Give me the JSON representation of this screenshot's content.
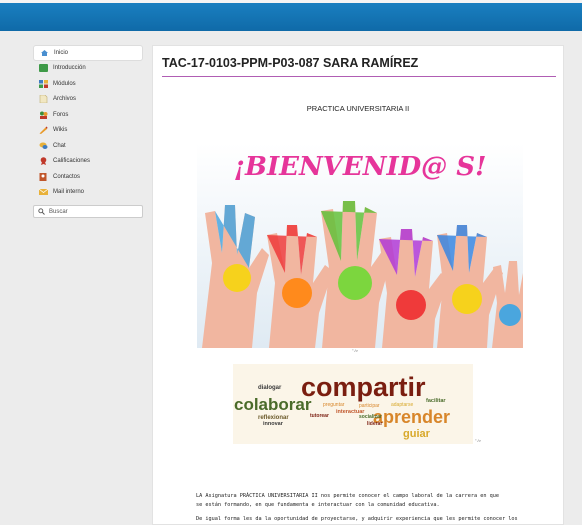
{
  "nav": {
    "items": [
      {
        "label": "Inicio",
        "icon": "home-icon",
        "color": "#4a8fd0",
        "active": true
      },
      {
        "label": "Introducción",
        "icon": "intro-icon",
        "color": "#3e9a48",
        "active": false
      },
      {
        "label": "Módulos",
        "icon": "modules-icon",
        "color": "#3e7bc0",
        "active": false
      },
      {
        "label": "Archivos",
        "icon": "files-icon",
        "color": "#e8d8a0",
        "active": false
      },
      {
        "label": "Foros",
        "icon": "forum-icon",
        "color": "#3c8d3c",
        "active": false
      },
      {
        "label": "Wikis",
        "icon": "wiki-icon",
        "color": "#e89a2a",
        "active": false
      },
      {
        "label": "Chat",
        "icon": "chat-icon",
        "color": "#e8b13a",
        "active": false
      },
      {
        "label": "Calificaciones",
        "icon": "grades-icon",
        "color": "#c0392b",
        "active": false
      },
      {
        "label": "Contactos",
        "icon": "contacts-icon",
        "color": "#c0562b",
        "active": false
      },
      {
        "label": "Mail interno",
        "icon": "mail-icon",
        "color": "#e8b13a",
        "active": false
      }
    ],
    "search_label": "Buscar"
  },
  "main": {
    "title": "TAC-17-0103-PPM-P03-087 SARA RAMÍREZ",
    "subtitle": "PRACTICA UNIVERSITARIA II",
    "banner_text": "¡BIENVENID@ S!",
    "caption1": "\" />",
    "caption2": "\" />",
    "cloud_words": {
      "w1": "compartir",
      "w2": "colaborar",
      "w3": "aprender",
      "w4": "guiar",
      "w5": "dialogar",
      "w6": "reflexionar",
      "w7": "innovar",
      "w8": "tutorear",
      "w9": "interactuar",
      "w10": "socializar",
      "w11": "liderar",
      "w12": "participar",
      "w13": "adaptarse",
      "w14": "facilitar",
      "w15": "preguntar"
    },
    "para1_line1": "LA Asignatura PRÁCTICA UNIVERSITARIA II nos permite conocer el campo laboral de la carrera en que",
    "para1_line2": "se están formando, en que fundamenta e interactuar con la comunidad educativa.",
    "para2_line1": "De igual forma les da la oportunidad de proyectarse, y adquirir experiencia que les permite conocer los"
  }
}
